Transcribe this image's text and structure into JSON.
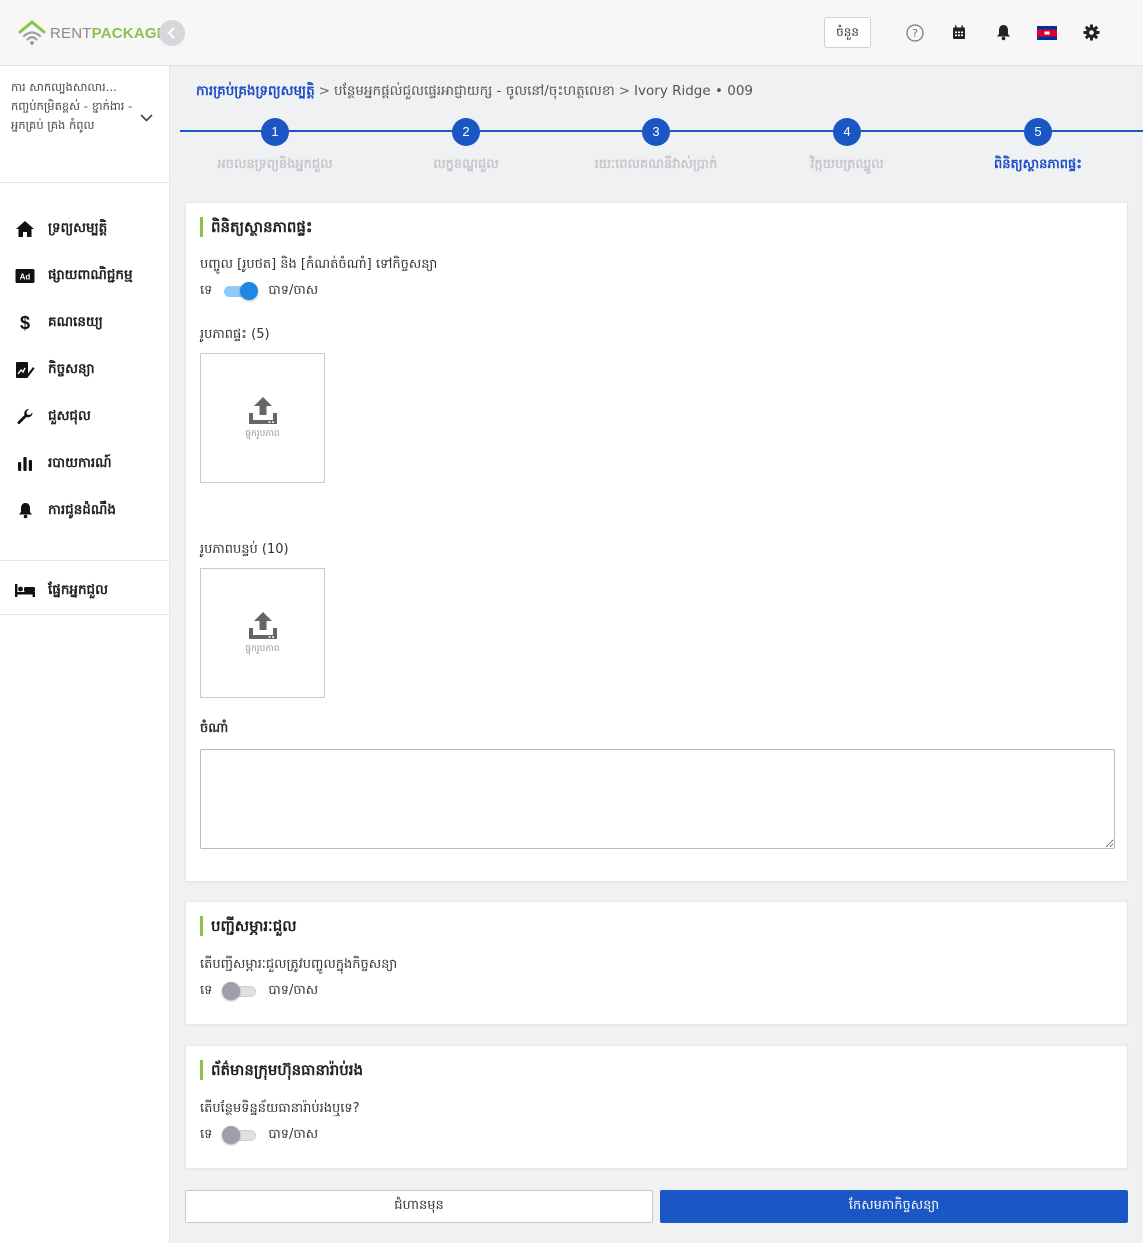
{
  "app": {
    "logo_text_a": "RENT",
    "logo_text_b": "PACKAGE"
  },
  "topbar": {
    "dashboard_label": "ចំនួន",
    "flag": "cambodia-flag"
  },
  "sidebar": {
    "property_selector": "ការ សាកល្បងសាលារ... កញ្ចប់កម្រិតខ្ពស់ - ខ្នាក់ងារ - អ្នកគ្រប់ គ្រង កំពូល",
    "items": [
      {
        "label": "ទ្រព្យសម្បត្តិ",
        "icon": "home-icon"
      },
      {
        "label": "ផ្សាយពាណិជ្ជកម្ម",
        "icon": "ad-icon"
      },
      {
        "label": "គណនេយ្យ",
        "icon": "dollar-icon"
      },
      {
        "label": "កិច្ចសន្យា",
        "icon": "contract-icon"
      },
      {
        "label": "ជួសជុល",
        "icon": "wrench-icon"
      },
      {
        "label": "របាយការណ៍",
        "icon": "bar-chart-icon"
      },
      {
        "label": "ការជូនដំណឹង",
        "icon": "bell-icon"
      }
    ],
    "tenant_item": {
      "label": "ផ្នែកអ្នកជួល",
      "icon": "bed-icon"
    }
  },
  "breadcrumb": {
    "root": "ការគ្រប់គ្រងទ្រព្យសម្បត្តិ",
    "middle": "បន្ថែមអ្នកផ្តល់ជួលផ្ទេរអាជ្ញាយក្ស - ចូលនៅ/ចុះហត្ថលេខា",
    "current": "Ivory Ridge • 009"
  },
  "stepper": {
    "steps": [
      {
        "num": "1",
        "label": "អចលនទ្រព្យនិងអ្នកជួល"
      },
      {
        "num": "2",
        "label": "លក្ខខណ្ឌជួល"
      },
      {
        "num": "3",
        "label": "រយៈពេលគណនីវាស់ប្រាក់"
      },
      {
        "num": "4",
        "label": "វិក្កយបត្រឈ្នួល"
      },
      {
        "num": "5",
        "label": "ពិនិត្យស្ថានភាពផ្ទះ"
      }
    ],
    "active_index": 4
  },
  "inspection": {
    "title": "ពិនិត្យស្ថានភាពផ្ទះ",
    "include_label": "បញ្ចូល [រូបថត] និង [កំណត់ចំណាំ] ទៅកិច្ចសន្យា",
    "no_label": "ទេ",
    "yes_label": "បាទ/ចាស",
    "include_on": true,
    "house_photos_label": "រូបភាពផ្ទះ",
    "house_photos_count": "(5)",
    "room_photos_label": "រូបភាពបន្ទប់",
    "room_photos_count": "(10)",
    "upload_text": "ផ្ទុករូបភាព",
    "notes_label": "ចំណាំ",
    "notes_value": ""
  },
  "inventory": {
    "title": "បញ្ជីសម្ភារៈជួល",
    "question": "តើបញ្ជីសម្ភារៈជួលត្រូវបញ្ចូលក្នុងកិច្ចសន្យា",
    "no_label": "ទេ",
    "yes_label": "បាទ/ចាស",
    "on": false
  },
  "insurance": {
    "title": "ព័ត៌មានក្រុមហ៊ុនធានារ៉ាប់រង",
    "question": "តើបន្ថែមទិន្នន័យធានារ៉ាប់រងឬទេ?",
    "no_label": "ទេ",
    "yes_label": "បាទ/ចាស",
    "on": false
  },
  "actions": {
    "back_label": "ជំហានមុន",
    "finish_label": "កែសមភាកិច្ចសន្យា"
  },
  "colors": {
    "primary": "#1a56c4",
    "accent_green": "#8bc34a",
    "toggle_on": "#1e88e5"
  }
}
